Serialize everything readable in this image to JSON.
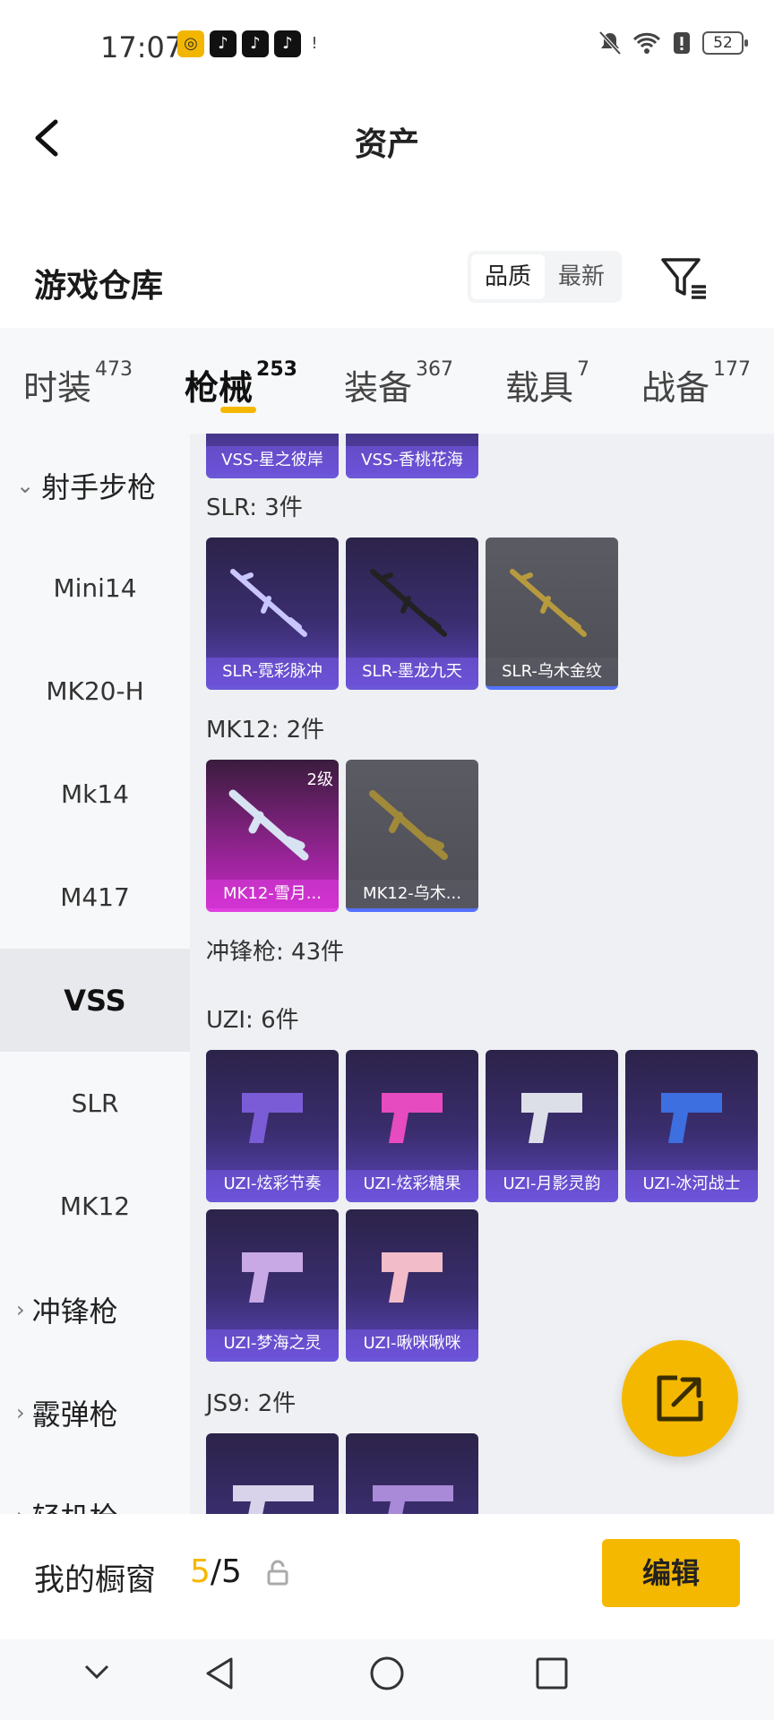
{
  "status_bar": {
    "time": "17:07",
    "battery": "52",
    "apps": [
      "◎",
      "♪",
      "♪",
      "♪",
      "!"
    ],
    "right_icons": [
      "bell-off-icon",
      "wifi-icon",
      "alert-icon"
    ]
  },
  "nav": {
    "title": "资产"
  },
  "warehouse": {
    "title": "游戏仓库",
    "sort_options": [
      "品质",
      "最新"
    ],
    "active_sort": "品质"
  },
  "tabs": [
    {
      "label": "时装",
      "count": "473"
    },
    {
      "label": "枪械",
      "count": "253"
    },
    {
      "label": "装备",
      "count": "367"
    },
    {
      "label": "载具",
      "count": "7"
    },
    {
      "label": "战备",
      "count": "177"
    }
  ],
  "active_tab": "枪械",
  "sidebar": {
    "items": [
      {
        "label": "射手步枪",
        "type": "category",
        "chev": "⌄"
      },
      {
        "label": "Mini14",
        "type": "item"
      },
      {
        "label": "MK20-H",
        "type": "item"
      },
      {
        "label": "Mk14",
        "type": "item"
      },
      {
        "label": "M417",
        "type": "item"
      },
      {
        "label": "VSS",
        "type": "item",
        "active": true
      },
      {
        "label": "SLR",
        "type": "item"
      },
      {
        "label": "MK12",
        "type": "item"
      },
      {
        "label": "冲锋枪",
        "type": "category",
        "chev": "›"
      },
      {
        "label": "霰弹枪",
        "type": "category",
        "chev": "›"
      },
      {
        "label": "轻机枪",
        "type": "category",
        "chev": "›"
      }
    ]
  },
  "content": {
    "vss_cards": [
      "VSS-星之彼岸",
      "VSS-香桃花海"
    ],
    "slr": {
      "header": "SLR: 3件",
      "cards": [
        "SLR-霓彩脉冲",
        "SLR-墨龙九天",
        "SLR-乌木金纹"
      ]
    },
    "mk12": {
      "header": "MK12: 2件",
      "cards": [
        "MK12-雪月...",
        "MK12-乌木..."
      ],
      "level": "2级"
    },
    "smg_header": "冲锋枪: 43件",
    "uzi": {
      "header": "UZI: 6件",
      "cards": [
        "UZI-炫彩节奏",
        "UZI-炫彩糖果",
        "UZI-月影灵韵",
        "UZI-冰河战士",
        "UZI-梦海之灵",
        "UZI-啾咪啾咪"
      ]
    },
    "js9": {
      "header": "JS9: 2件"
    }
  },
  "bottom": {
    "label": "我的橱窗",
    "count_used": "5",
    "count_sep": "/",
    "count_total": "5",
    "edit_label": "编辑"
  },
  "colors": {
    "accent": "#f5b800"
  }
}
